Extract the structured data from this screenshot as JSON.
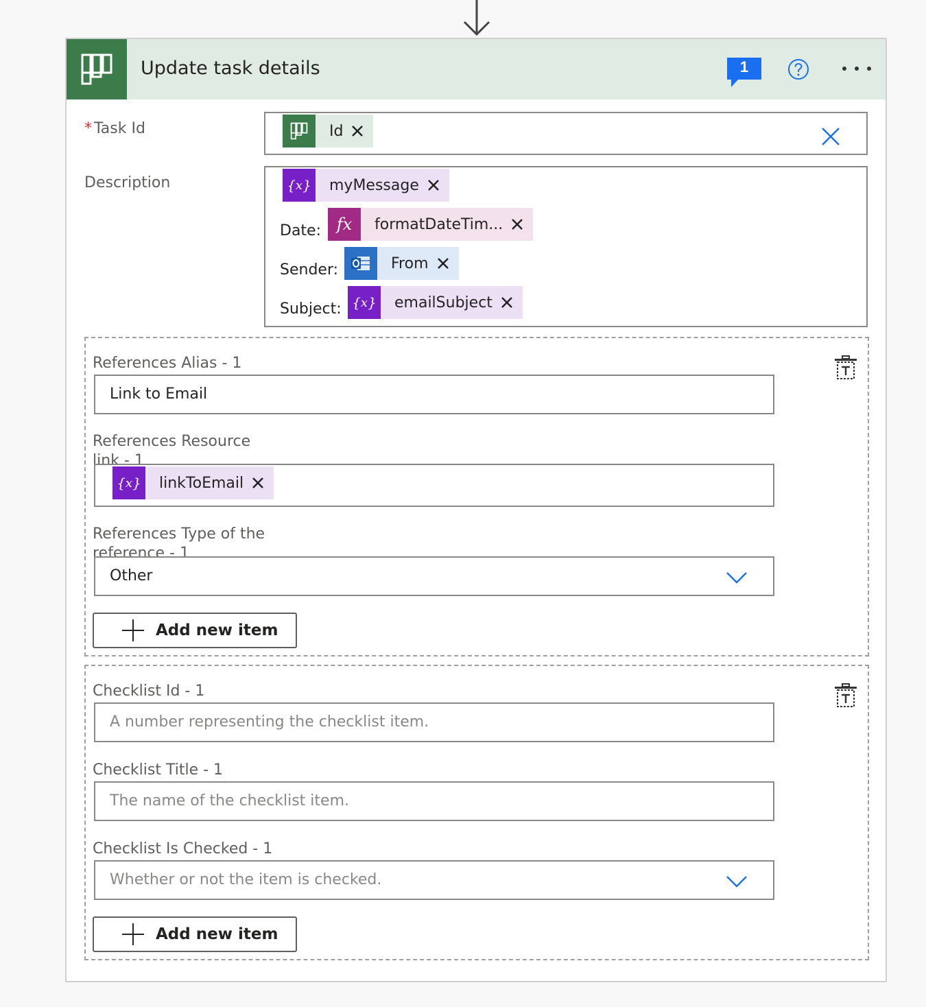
{
  "action": {
    "title": "Update task details",
    "comment_count": "1",
    "header_icon": "planner-icon",
    "colors": {
      "planner": "#3b7c4a",
      "header_bg": "#e0ebe3",
      "accent": "#1a73e8",
      "variable": "#7720c8",
      "expression": "#a12a84",
      "outlook": "#2b72c6"
    }
  },
  "task_id": {
    "label": "Task Id",
    "required_mark": "*",
    "token": {
      "label": "Id",
      "icon": "planner-icon"
    }
  },
  "description": {
    "label": "Description",
    "token1": {
      "label": "myMessage",
      "icon": "variable-icon"
    },
    "date_label": "Date:",
    "token2": {
      "label": "formatDateTim...",
      "icon": "expression-icon"
    },
    "sender_label": "Sender:",
    "token3": {
      "label": "From",
      "icon": "outlook-icon"
    },
    "subject_label": "Subject:",
    "token4": {
      "label": "emailSubject",
      "icon": "variable-icon"
    }
  },
  "references": {
    "alias_label": "References Alias - 1",
    "alias_value": "Link to Email",
    "resource_label": "References Resource link - 1",
    "resource_token": {
      "label": "linkToEmail",
      "icon": "variable-icon"
    },
    "type_label": "References Type of the reference - 1",
    "type_value": "Other",
    "add_label": "Add new item"
  },
  "checklist": {
    "id_label": "Checklist Id - 1",
    "id_placeholder": "A number representing the checklist item.",
    "title_label": "Checklist Title - 1",
    "title_placeholder": "The name of the checklist item.",
    "checked_label": "Checklist Is Checked - 1",
    "checked_placeholder": "Whether or not the item is checked.",
    "add_label": "Add new item"
  }
}
